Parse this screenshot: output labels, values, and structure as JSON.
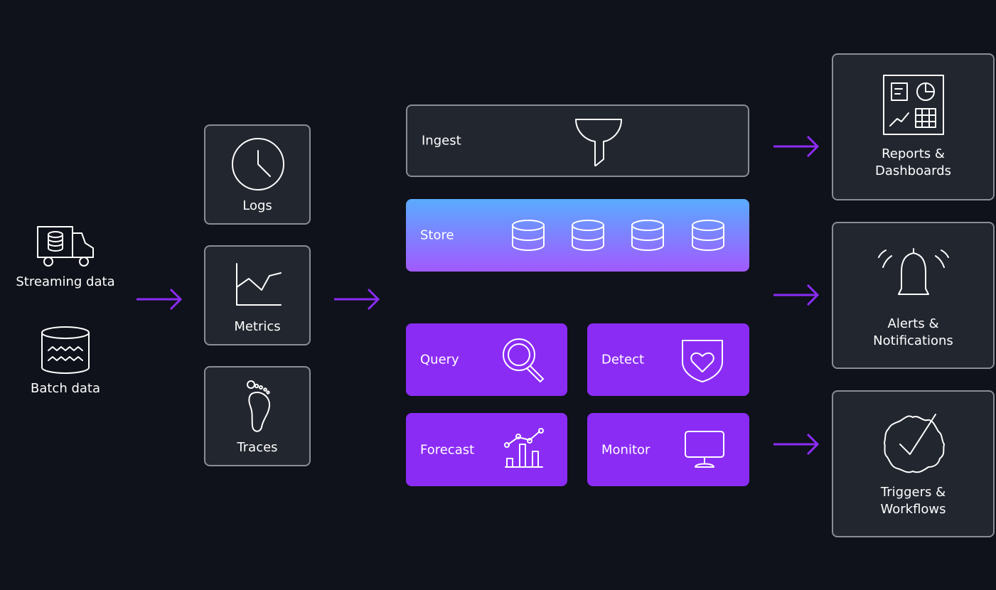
{
  "colors": {
    "background": "#0f121a",
    "card": "#22262f",
    "border": "#8a8d92",
    "accent": "#8b2cf5",
    "store_gradient": [
      "#5aabff",
      "#a259ff"
    ]
  },
  "sources": [
    {
      "label": "Streaming data",
      "icon": "truck-database-icon"
    },
    {
      "label": "Batch data",
      "icon": "data-lake-icon"
    }
  ],
  "signals": [
    {
      "label": "Logs",
      "icon": "clock-icon"
    },
    {
      "label": "Metrics",
      "icon": "line-chart-icon"
    },
    {
      "label": "Traces",
      "icon": "footprint-icon"
    }
  ],
  "platform": {
    "ingest": {
      "label": "Ingest",
      "icon": "funnel-icon"
    },
    "store": {
      "label": "Store",
      "icon": "database-icon"
    },
    "query": {
      "label": "Query",
      "icon": "magnifier-icon"
    },
    "detect": {
      "label": "Detect",
      "icon": "shield-heart-icon"
    },
    "forecast": {
      "label": "Forecast",
      "icon": "bar-line-chart-icon"
    },
    "monitor": {
      "label": "Monitor",
      "icon": "monitor-icon"
    }
  },
  "outputs": [
    {
      "line1": "Reports &",
      "line2": "Dashboards",
      "icon": "dashboard-icon"
    },
    {
      "line1": "Alerts &",
      "line2": "Notifications",
      "icon": "bell-icon"
    },
    {
      "line1": "Triggers &",
      "line2": "Workflows",
      "icon": "badge-check-icon"
    }
  ]
}
